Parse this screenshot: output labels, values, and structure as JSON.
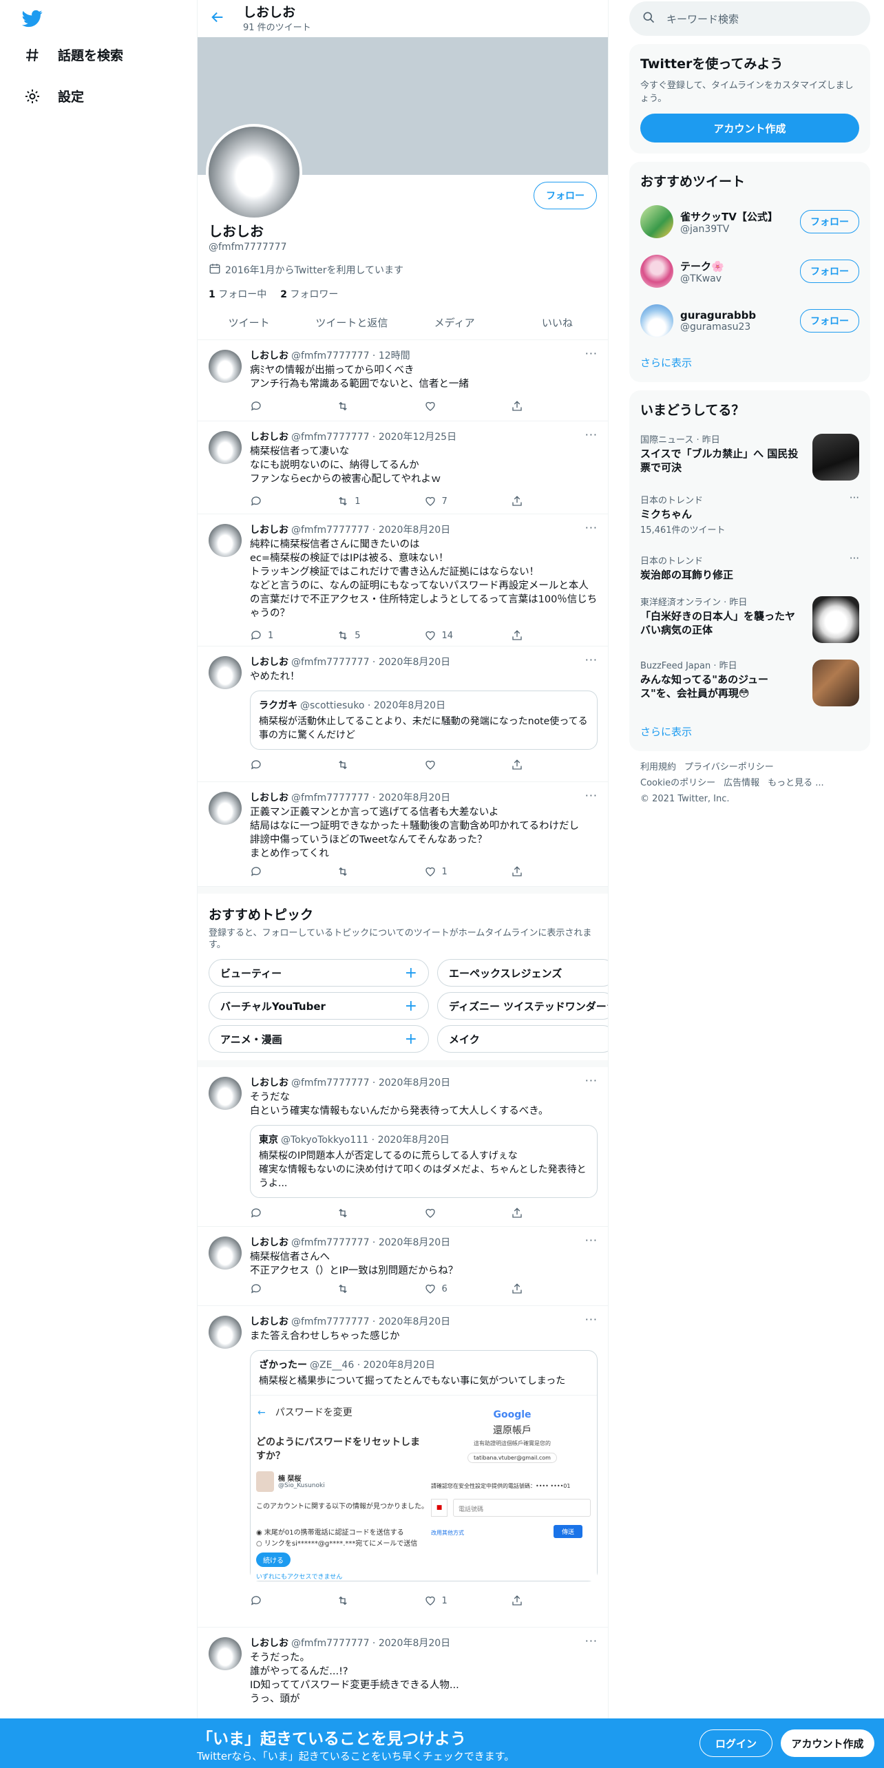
{
  "sidebar": {
    "explore_label": "話題を検索",
    "settings_label": "設定"
  },
  "header": {
    "title": "しおしお",
    "tweet_count": "91 件のツイート"
  },
  "profile": {
    "name": "しおしお",
    "handle": "@fmfm7777777",
    "joined": "2016年1月からTwitterを利用しています",
    "following_count": "1",
    "following_label": "フォロー中",
    "followers_count": "2",
    "followers_label": "フォロワー",
    "follow_button": "フォロー"
  },
  "tabs": [
    "ツイート",
    "ツイートと返信",
    "メディア",
    "いいね"
  ],
  "tweets": [
    {
      "name": "しおしお",
      "meta": "@fmfm7777777 · 12時間",
      "text": "病ﾐヤの情報が出揃ってから叩くべき\nアンチ行為も常識ある範囲でないと、信者と一緒",
      "reply": "",
      "rt": "",
      "like": ""
    },
    {
      "name": "しおしお",
      "meta": "@fmfm7777777 · 2020年12月25日",
      "text": "楠栞桜信者って凄いな\nなにも説明ないのに、納得してるんか\nファンならecからの被害心配してやれよｗ",
      "reply": "",
      "rt": "1",
      "like": "7"
    },
    {
      "name": "しおしお",
      "meta": "@fmfm7777777 · 2020年8月20日",
      "text": "純粋に楠栞桜信者さんに聞きたいのは\nec=楠栞桜の検証ではIPは被る、意味ない！\nトラッキング検証ではこれだけで書き込んだ証拠にはならない！\nなどと言うのに、なんの証明にもなってないパスワード再設定メールと本人の言葉だけで不正アクセス・住所特定しようとしてるって言葉は100％信じちゃうの？",
      "reply": "1",
      "rt": "5",
      "like": "14"
    },
    {
      "name": "しおしお",
      "meta": "@fmfm7777777 · 2020年8月20日",
      "text": "やめたれ！",
      "reply": "",
      "rt": "",
      "like": ""
    },
    {
      "name": "しおしお",
      "meta": "@fmfm7777777 · 2020年8月20日",
      "text": "正義マン正義マンとか言って逃げてる信者も大差ないよ\n結局はなに一つ証明できなかった＋騒動後の言動含め叩かれてるわけだし\n誹謗中傷っていうほどのTweetなんてそんなあった？\nまとめ作ってくれ",
      "reply": "",
      "rt": "",
      "like": "1"
    },
    {
      "name": "しおしお",
      "meta": "@fmfm7777777 · 2020年8月20日",
      "text": "そうだな\n白という確実な情報もないんだから発表待って大人しくするべき。",
      "reply": "",
      "rt": "",
      "like": ""
    },
    {
      "name": "しおしお",
      "meta": "@fmfm7777777 · 2020年8月20日",
      "text": "楠栞桜信者さんへ\n不正アクセス（）とIP一致は別問題だからね？",
      "reply": "",
      "rt": "",
      "like": "6"
    },
    {
      "name": "しおしお",
      "meta": "@fmfm7777777 · 2020年8月20日",
      "text": "また答え合わせしちゃった感じか",
      "reply": "",
      "rt": "",
      "like": "1"
    },
    {
      "name": "しおしお",
      "meta": "@fmfm7777777 · 2020年8月20日",
      "text": "そうだった。\n誰がやってるんだ...!?\nID知っててパスワード変更手続きできる人物...\nうっ、頭が",
      "reply": "",
      "rt": "",
      "like": ""
    }
  ],
  "quotes": {
    "q1": {
      "name": "ラクガキ",
      "meta": "@scottiesuko · 2020年8月20日",
      "text": "楠栞桜が活動休止してることより、未だに騒動の発端になったnote使ってる事の方に驚くんだけど"
    },
    "q2": {
      "name": "東京",
      "meta": "@TokyoTokkyo111 · 2020年8月20日",
      "text": "楠栞桜のIP問題本人が否定してるのに荒らしてる人すげぇな\n確実な情報もないのに決め付けて叩くのはダメだよ、ちゃんとした発表待とうよ..."
    },
    "q3": {
      "name": "ざかったー",
      "meta": "@ZE__46 · 2020年8月20日",
      "text": "楠栞桜と橘果歩について掘ってたとんでもない事に気がついてしまった"
    }
  },
  "quote_image": {
    "back_title": "パスワードを変更",
    "question": "どのようにパスワードをリセットしますか？",
    "user_name": "楠 栞桜",
    "user_handle": "@Sio_Kusunoki",
    "info": "このアカウントに関する以下の情報が見つかりました。",
    "opt1": "末尾が01の携帯電話に認証コードを送信する",
    "opt2": "リンクをsi******@g****.***宛てにメールで送信",
    "continue": "続ける",
    "no_access": "いずれにもアクセスできません",
    "google": "Google",
    "g_title": "還原帳戶",
    "g_sub": "這有助證明這個帳戶確實是您的",
    "g_email": "tatibana.vtuber@gmail.com",
    "g_prompt": "請確認您在安全性設定中提供的電話號碼：•••• ••••01",
    "g_field": "電話號碼",
    "g_try": "改用其他方式",
    "g_next": "傳送"
  },
  "topics": {
    "title": "おすすめトピック",
    "desc": "登録すると、フォローしているトピックについてのツイートがホームタイムラインに表示されます。",
    "items": [
      "ビューティー",
      "エーペックスレジェンズ",
      "バーチャルYouTuber",
      "ディズニー ツイステッドワンダーランド",
      "アニメ・漫画",
      "メイク"
    ]
  },
  "right": {
    "search_placeholder": "キーワード検索",
    "signup_title": "Twitterを使ってみよう",
    "signup_text": "今すぐ登録して、タイムラインをカスタマイズしましょう。",
    "signup_button": "アカウント作成",
    "wtf_title": "おすすめツイート",
    "wtf": [
      {
        "name": "雀サクッTV【公式】",
        "handle": "@jan39TV",
        "button": "フォロー"
      },
      {
        "name": "テーク🌸",
        "handle": "@TKwav",
        "button": "フォロー"
      },
      {
        "name": "guragurabbb",
        "handle": "@guramasu23",
        "button": "フォロー"
      }
    ],
    "show_more": "さらに表示",
    "trends_title": "いまどうしてる？",
    "trends": [
      {
        "ctx": "国際ニュース · 昨日",
        "title": "スイスで「ブルカ禁止」へ 国民投票で可決",
        "count": ""
      },
      {
        "ctx": "日本のトレンド",
        "title": "ミクちゃん",
        "count": "15,461件のツイート"
      },
      {
        "ctx": "日本のトレンド",
        "title": "炭治郎の耳飾り修正",
        "count": ""
      },
      {
        "ctx": "東洋経済オンライン · 昨日",
        "title": "「白米好きの日本人」を襲ったヤバい病気の正体",
        "count": ""
      },
      {
        "ctx": "BuzzFeed Japan · 昨日",
        "title": "みんな知ってる\"あのジュース\"を、会社員が再現😳",
        "count": ""
      }
    ],
    "show_more2": "さらに表示",
    "footer": [
      "利用規約",
      "プライバシーポリシー",
      "Cookieのポリシー",
      "広告情報",
      "もっと見る ...",
      "© 2021 Twitter, Inc."
    ]
  },
  "bottom": {
    "title": "「いま」起きていることを見つけよう",
    "sub": "Twitterなら、「いま」起きていることをいち早くチェックできます。",
    "login": "ログイン",
    "signup": "アカウント作成"
  },
  "colors": {
    "accent": "#1d9bf0",
    "banner": "#c4cfd6"
  }
}
